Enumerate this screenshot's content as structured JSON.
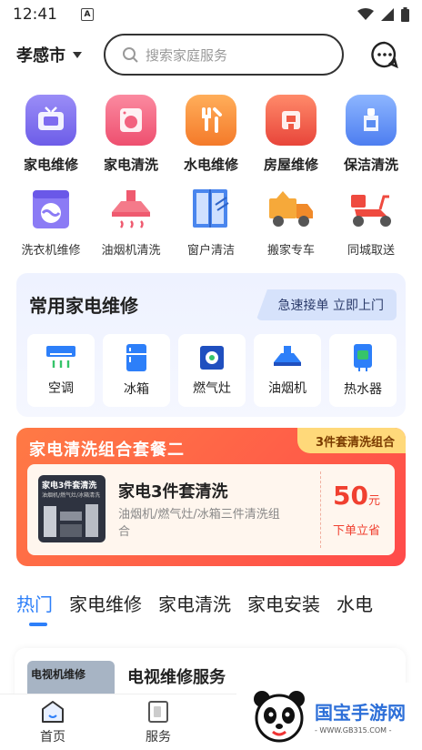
{
  "status_bar": {
    "time": "12:41",
    "a_label": "A"
  },
  "header": {
    "city": "孝感市",
    "search_placeholder": "搜索家庭服务"
  },
  "categories_main": [
    {
      "label": "家电维修",
      "icon": "tv-repair-icon",
      "color": "#7e6bf0"
    },
    {
      "label": "家电清洗",
      "icon": "washer-clean-icon",
      "color": "#f2627f"
    },
    {
      "label": "水电维修",
      "icon": "wrench-icon",
      "color": "#f6883a"
    },
    {
      "label": "房屋维修",
      "icon": "house-repair-icon",
      "color": "#ef5a45"
    },
    {
      "label": "保洁清洗",
      "icon": "cleaning-icon",
      "color": "#5b8df2"
    }
  ],
  "categories_sub": [
    {
      "label": "洗衣机维修",
      "icon": "washing-machine-icon"
    },
    {
      "label": "油烟机清洗",
      "icon": "range-hood-icon"
    },
    {
      "label": "窗户清洁",
      "icon": "window-icon"
    },
    {
      "label": "搬家专车",
      "icon": "truck-icon"
    },
    {
      "label": "同城取送",
      "icon": "scooter-icon"
    }
  ],
  "repair_section": {
    "title": "常用家电维修",
    "tag": "急速接单 立即上门",
    "items": [
      {
        "label": "空调",
        "icon": "air-conditioner-icon"
      },
      {
        "label": "冰箱",
        "icon": "fridge-icon"
      },
      {
        "label": "燃气灶",
        "icon": "gas-stove-icon"
      },
      {
        "label": "油烟机",
        "icon": "range-hood-icon"
      },
      {
        "label": "热水器",
        "icon": "water-heater-icon"
      }
    ]
  },
  "promo": {
    "title": "家电清洗组合套餐二",
    "tag": "3件套清洗组合",
    "thumb_title": "家电3件套清洗",
    "thumb_sub": "油烟机/燃气灶/冰箱清洗",
    "name": "家电3件套清洗",
    "desc": "油烟机/燃气灶/冰箱三件清洗组合",
    "price": "50",
    "unit": "元",
    "order": "下单立省"
  },
  "tabs": [
    "热门",
    "家电维修",
    "家电清洗",
    "家电安装",
    "水电"
  ],
  "service": {
    "thumb_text": "电视机维修",
    "title": "电视维修服务"
  },
  "nav": [
    {
      "label": "首页",
      "icon": "home-icon"
    },
    {
      "label": "服务",
      "icon": "service-icon"
    }
  ],
  "watermark": {
    "name": "国宝手游网",
    "url": "- WWW.GB315.COM -"
  },
  "colors": {
    "accent": "#2d7ff9",
    "promo": "#ff5a45",
    "price": "#f04030"
  }
}
